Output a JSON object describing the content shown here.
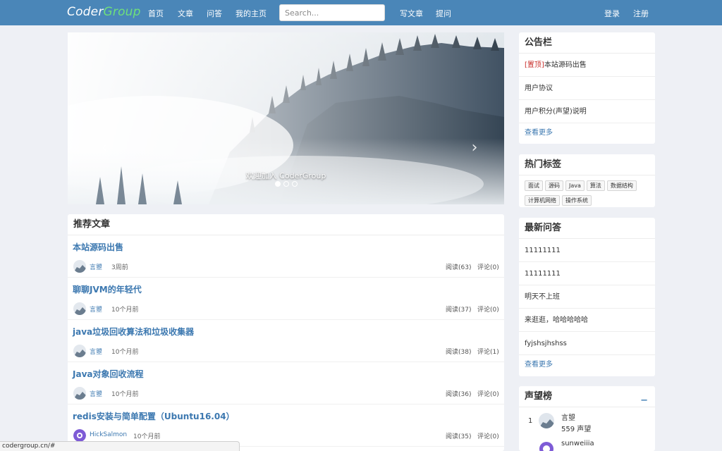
{
  "brand": {
    "part1": "Coder",
    "part2": "Group"
  },
  "nav": {
    "links": [
      "首页",
      "文章",
      "问答",
      "我的主页"
    ],
    "search_placeholder": "Search...",
    "write": "写文章",
    "ask": "提问",
    "login": "登录",
    "register": "注册"
  },
  "carousel": {
    "caption": "欢迎加入 CoderGroup",
    "prev_icon": "chevron-left-icon",
    "next_icon": "chevron-right-icon",
    "slides": 3,
    "active": 0
  },
  "articles": {
    "title": "推荐文章",
    "items": [
      {
        "title": "本站源码出售",
        "author": "言曌",
        "time": "3周前",
        "reads": "阅读(63)",
        "comments": "评论(0)"
      },
      {
        "title": "聊聊JVM的年轻代",
        "author": "言曌",
        "time": "10个月前",
        "reads": "阅读(37)",
        "comments": "评论(0)"
      },
      {
        "title": "java垃圾回收算法和垃圾收集器",
        "author": "言曌",
        "time": "10个月前",
        "reads": "阅读(38)",
        "comments": "评论(1)"
      },
      {
        "title": "Java对象回收流程",
        "author": "言曌",
        "time": "10个月前",
        "reads": "阅读(36)",
        "comments": "评论(0)"
      },
      {
        "title": "redis安装与简单配置（Ubuntu16.04）",
        "author": "HickSalmon",
        "time": "10个月前",
        "reads": "阅读(35)",
        "comments": "评论(0)"
      }
    ]
  },
  "notice": {
    "title": "公告栏",
    "pinned_tag": "[置顶]",
    "items": [
      "本站源码出售",
      "用户协议",
      "用户积分(声望)说明"
    ],
    "more": "查看更多"
  },
  "hot_tags": {
    "title": "热门标签",
    "tags": [
      "面试",
      "源码",
      "Java",
      "算法",
      "数据结构",
      "计算机网络",
      "操作系统"
    ]
  },
  "latest_qa": {
    "title": "最新问答",
    "items": [
      "11111111",
      "11111111",
      "明天不上班",
      "来逛逛，哈哈哈哈哈",
      "fyjshsjhshss"
    ],
    "more": "查看更多"
  },
  "reputation": {
    "title": "声望榜",
    "collapse": "−",
    "rows": [
      {
        "rank": "1",
        "name": "言曌",
        "score": "559 声望"
      },
      {
        "rank": "",
        "name": "sunweiiia",
        "score": ""
      }
    ]
  },
  "status_url": "codergroup.cn/#"
}
